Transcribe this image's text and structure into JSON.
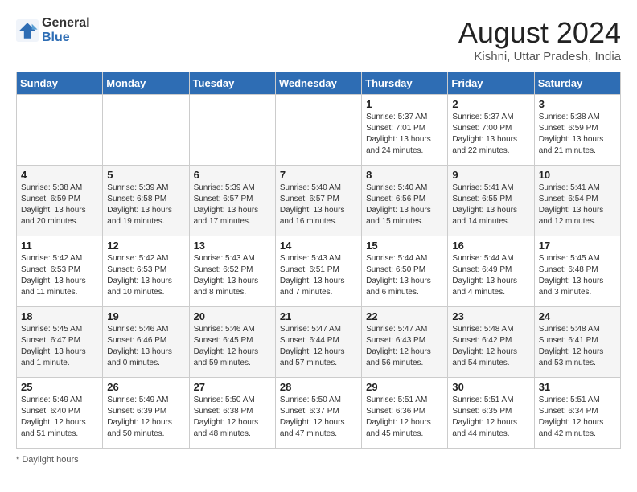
{
  "header": {
    "logo_general": "General",
    "logo_blue": "Blue",
    "title": "August 2024",
    "subtitle": "Kishni, Uttar Pradesh, India"
  },
  "days_of_week": [
    "Sunday",
    "Monday",
    "Tuesday",
    "Wednesday",
    "Thursday",
    "Friday",
    "Saturday"
  ],
  "footer": {
    "note": "Daylight hours"
  },
  "weeks": [
    [
      {
        "day": "",
        "sunrise": "",
        "sunset": "",
        "daylight": ""
      },
      {
        "day": "",
        "sunrise": "",
        "sunset": "",
        "daylight": ""
      },
      {
        "day": "",
        "sunrise": "",
        "sunset": "",
        "daylight": ""
      },
      {
        "day": "",
        "sunrise": "",
        "sunset": "",
        "daylight": ""
      },
      {
        "day": "1",
        "sunrise": "Sunrise: 5:37 AM",
        "sunset": "Sunset: 7:01 PM",
        "daylight": "Daylight: 13 hours and 24 minutes."
      },
      {
        "day": "2",
        "sunrise": "Sunrise: 5:37 AM",
        "sunset": "Sunset: 7:00 PM",
        "daylight": "Daylight: 13 hours and 22 minutes."
      },
      {
        "day": "3",
        "sunrise": "Sunrise: 5:38 AM",
        "sunset": "Sunset: 6:59 PM",
        "daylight": "Daylight: 13 hours and 21 minutes."
      }
    ],
    [
      {
        "day": "4",
        "sunrise": "Sunrise: 5:38 AM",
        "sunset": "Sunset: 6:59 PM",
        "daylight": "Daylight: 13 hours and 20 minutes."
      },
      {
        "day": "5",
        "sunrise": "Sunrise: 5:39 AM",
        "sunset": "Sunset: 6:58 PM",
        "daylight": "Daylight: 13 hours and 19 minutes."
      },
      {
        "day": "6",
        "sunrise": "Sunrise: 5:39 AM",
        "sunset": "Sunset: 6:57 PM",
        "daylight": "Daylight: 13 hours and 17 minutes."
      },
      {
        "day": "7",
        "sunrise": "Sunrise: 5:40 AM",
        "sunset": "Sunset: 6:57 PM",
        "daylight": "Daylight: 13 hours and 16 minutes."
      },
      {
        "day": "8",
        "sunrise": "Sunrise: 5:40 AM",
        "sunset": "Sunset: 6:56 PM",
        "daylight": "Daylight: 13 hours and 15 minutes."
      },
      {
        "day": "9",
        "sunrise": "Sunrise: 5:41 AM",
        "sunset": "Sunset: 6:55 PM",
        "daylight": "Daylight: 13 hours and 14 minutes."
      },
      {
        "day": "10",
        "sunrise": "Sunrise: 5:41 AM",
        "sunset": "Sunset: 6:54 PM",
        "daylight": "Daylight: 13 hours and 12 minutes."
      }
    ],
    [
      {
        "day": "11",
        "sunrise": "Sunrise: 5:42 AM",
        "sunset": "Sunset: 6:53 PM",
        "daylight": "Daylight: 13 hours and 11 minutes."
      },
      {
        "day": "12",
        "sunrise": "Sunrise: 5:42 AM",
        "sunset": "Sunset: 6:53 PM",
        "daylight": "Daylight: 13 hours and 10 minutes."
      },
      {
        "day": "13",
        "sunrise": "Sunrise: 5:43 AM",
        "sunset": "Sunset: 6:52 PM",
        "daylight": "Daylight: 13 hours and 8 minutes."
      },
      {
        "day": "14",
        "sunrise": "Sunrise: 5:43 AM",
        "sunset": "Sunset: 6:51 PM",
        "daylight": "Daylight: 13 hours and 7 minutes."
      },
      {
        "day": "15",
        "sunrise": "Sunrise: 5:44 AM",
        "sunset": "Sunset: 6:50 PM",
        "daylight": "Daylight: 13 hours and 6 minutes."
      },
      {
        "day": "16",
        "sunrise": "Sunrise: 5:44 AM",
        "sunset": "Sunset: 6:49 PM",
        "daylight": "Daylight: 13 hours and 4 minutes."
      },
      {
        "day": "17",
        "sunrise": "Sunrise: 5:45 AM",
        "sunset": "Sunset: 6:48 PM",
        "daylight": "Daylight: 13 hours and 3 minutes."
      }
    ],
    [
      {
        "day": "18",
        "sunrise": "Sunrise: 5:45 AM",
        "sunset": "Sunset: 6:47 PM",
        "daylight": "Daylight: 13 hours and 1 minute."
      },
      {
        "day": "19",
        "sunrise": "Sunrise: 5:46 AM",
        "sunset": "Sunset: 6:46 PM",
        "daylight": "Daylight: 13 hours and 0 minutes."
      },
      {
        "day": "20",
        "sunrise": "Sunrise: 5:46 AM",
        "sunset": "Sunset: 6:45 PM",
        "daylight": "Daylight: 12 hours and 59 minutes."
      },
      {
        "day": "21",
        "sunrise": "Sunrise: 5:47 AM",
        "sunset": "Sunset: 6:44 PM",
        "daylight": "Daylight: 12 hours and 57 minutes."
      },
      {
        "day": "22",
        "sunrise": "Sunrise: 5:47 AM",
        "sunset": "Sunset: 6:43 PM",
        "daylight": "Daylight: 12 hours and 56 minutes."
      },
      {
        "day": "23",
        "sunrise": "Sunrise: 5:48 AM",
        "sunset": "Sunset: 6:42 PM",
        "daylight": "Daylight: 12 hours and 54 minutes."
      },
      {
        "day": "24",
        "sunrise": "Sunrise: 5:48 AM",
        "sunset": "Sunset: 6:41 PM",
        "daylight": "Daylight: 12 hours and 53 minutes."
      }
    ],
    [
      {
        "day": "25",
        "sunrise": "Sunrise: 5:49 AM",
        "sunset": "Sunset: 6:40 PM",
        "daylight": "Daylight: 12 hours and 51 minutes."
      },
      {
        "day": "26",
        "sunrise": "Sunrise: 5:49 AM",
        "sunset": "Sunset: 6:39 PM",
        "daylight": "Daylight: 12 hours and 50 minutes."
      },
      {
        "day": "27",
        "sunrise": "Sunrise: 5:50 AM",
        "sunset": "Sunset: 6:38 PM",
        "daylight": "Daylight: 12 hours and 48 minutes."
      },
      {
        "day": "28",
        "sunrise": "Sunrise: 5:50 AM",
        "sunset": "Sunset: 6:37 PM",
        "daylight": "Daylight: 12 hours and 47 minutes."
      },
      {
        "day": "29",
        "sunrise": "Sunrise: 5:51 AM",
        "sunset": "Sunset: 6:36 PM",
        "daylight": "Daylight: 12 hours and 45 minutes."
      },
      {
        "day": "30",
        "sunrise": "Sunrise: 5:51 AM",
        "sunset": "Sunset: 6:35 PM",
        "daylight": "Daylight: 12 hours and 44 minutes."
      },
      {
        "day": "31",
        "sunrise": "Sunrise: 5:51 AM",
        "sunset": "Sunset: 6:34 PM",
        "daylight": "Daylight: 12 hours and 42 minutes."
      }
    ]
  ]
}
